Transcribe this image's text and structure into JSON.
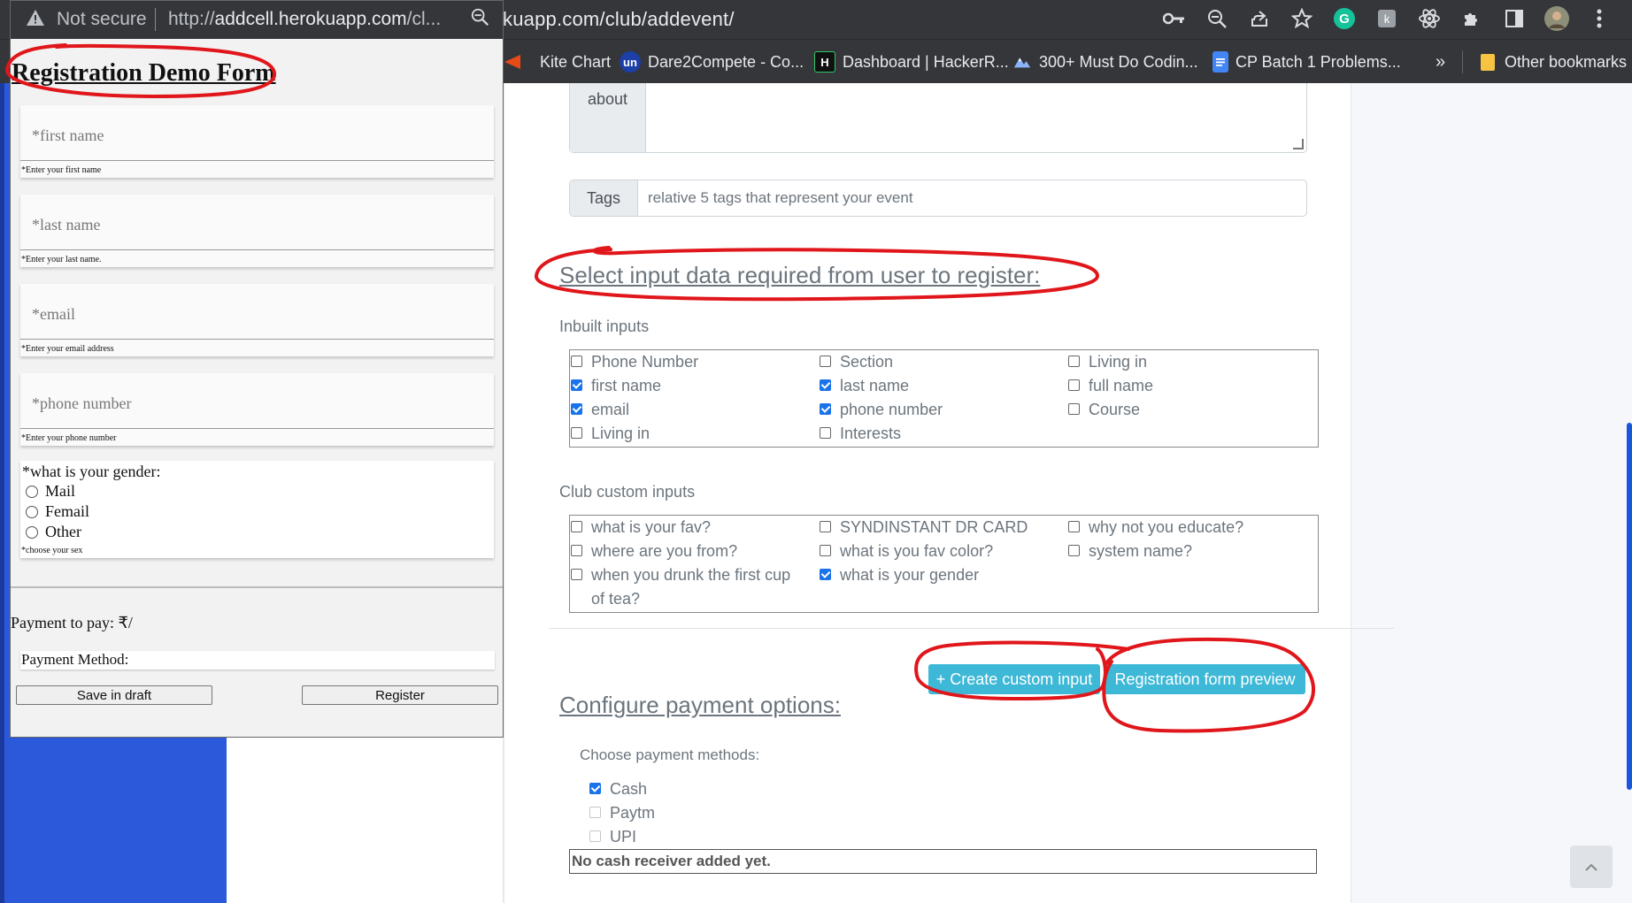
{
  "browser": {
    "main_url": "kuapp.com/club/addevent/",
    "bookmarks": [
      {
        "label": "Kite Chart",
        "icon": "kite-icon",
        "color": "#e64a19"
      },
      {
        "label": "Dare2Compete - Co...",
        "icon": "unstop-icon",
        "color": "#1c3fa8"
      },
      {
        "label": "Dashboard | HackerR...",
        "icon": "hackerrank-icon",
        "color": "#111111"
      },
      {
        "label": "300+ Must Do Codin...",
        "icon": "geeks-icon",
        "color": "#2f8d46"
      },
      {
        "label": "CP Batch 1 Problems...",
        "icon": "docs-icon",
        "color": "#4285f4"
      }
    ],
    "more_bookmarks": "»",
    "other_bookmarks": "Other bookmarks"
  },
  "popup": {
    "not_secure": "Not secure",
    "url_prefix": "http://",
    "url_host": "addcell.herokuapp.com",
    "url_rest": "/cl...",
    "form_title": "Registration Demo Form",
    "fields": [
      {
        "placeholder": "*first name",
        "help": "*Enter your first name"
      },
      {
        "placeholder": "*last name",
        "help": "*Enter your last name."
      },
      {
        "placeholder": "*email",
        "help": "*Enter your email address"
      },
      {
        "placeholder": "*phone number",
        "help": "*Enter your phone number"
      }
    ],
    "gender": {
      "question": "*what is your gender:",
      "options": [
        "Mail",
        "Femail",
        "Other"
      ],
      "help": "*choose your sex"
    },
    "payment_to_pay": "Payment to pay: ₹/",
    "payment_method": "Payment Method:",
    "save_draft": "Save in draft",
    "register": "Register"
  },
  "main": {
    "about_label": "about",
    "tags_label": "Tags",
    "tags_placeholder": "relative 5 tags that represent your event",
    "select_heading": "Select input data required from user to register:",
    "inbuilt_label": "Inbuilt inputs",
    "inbuilt_inputs": [
      {
        "label": "Phone Number",
        "checked": false
      },
      {
        "label": "first name",
        "checked": true
      },
      {
        "label": "email",
        "checked": true
      },
      {
        "label": "Living in",
        "checked": false
      },
      {
        "label": "Section",
        "checked": false
      },
      {
        "label": "last name",
        "checked": true
      },
      {
        "label": "phone number",
        "checked": true
      },
      {
        "label": "Interests",
        "checked": false
      },
      {
        "label": "Living in",
        "checked": false
      },
      {
        "label": "full name",
        "checked": false
      },
      {
        "label": "Course",
        "checked": false
      }
    ],
    "custom_label": "Club custom inputs",
    "custom_inputs": [
      {
        "label": "what is your fav?",
        "checked": false
      },
      {
        "label": "where are you from?",
        "checked": false
      },
      {
        "label": "when you drunk the first cup of tea?",
        "checked": false
      },
      {
        "label": "SYNDINSTANT DR CARD",
        "checked": false
      },
      {
        "label": "what is you fav color?",
        "checked": false
      },
      {
        "label": "what is your gender",
        "checked": true
      },
      {
        "label": "why not you educate?",
        "checked": false
      },
      {
        "label": "system name?",
        "checked": false
      }
    ],
    "create_custom_btn": "+ Create custom input",
    "preview_btn": "Registration form preview",
    "payment_heading": "Configure payment options:",
    "choose_methods": "Choose payment methods:",
    "methods": [
      {
        "label": "Cash",
        "checked": true
      },
      {
        "label": "Paytm",
        "checked": false
      },
      {
        "label": "UPI",
        "checked": false
      }
    ],
    "cash_receiver": "No cash receiver added yet.",
    "scroll_top": "⌃"
  },
  "colors": {
    "annotation_red": "#e0161b",
    "teal_button": "#3db8d6",
    "check_blue": "#1a73e8",
    "sidebar_blue": "#2b59d9"
  }
}
